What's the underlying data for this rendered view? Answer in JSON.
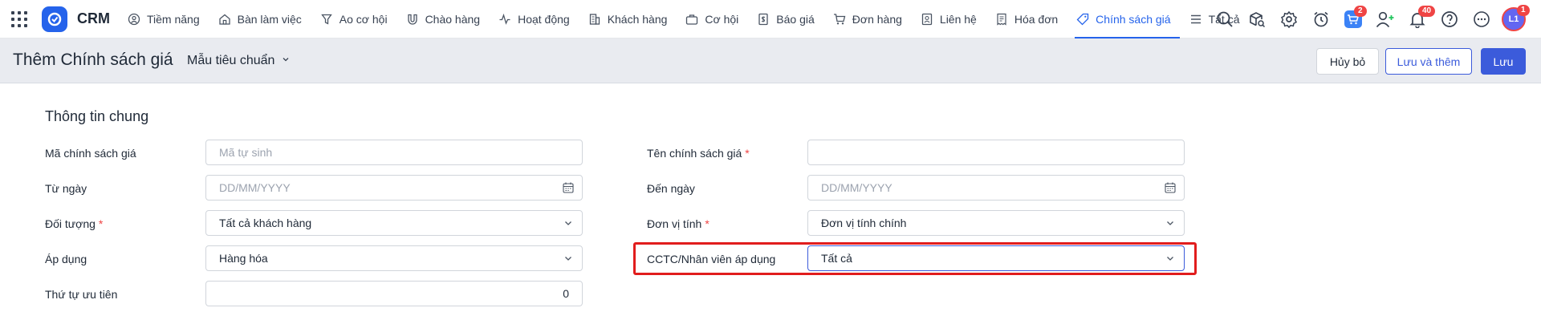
{
  "app": {
    "brand": "CRM"
  },
  "nav": {
    "items": [
      {
        "label": "Tiềm năng",
        "icon": "lead-icon"
      },
      {
        "label": "Bàn làm việc",
        "icon": "home-icon"
      },
      {
        "label": "Ao cơ hội",
        "icon": "funnel-icon"
      },
      {
        "label": "Chào hàng",
        "icon": "magnet-icon"
      },
      {
        "label": "Hoạt động",
        "icon": "activity-icon"
      },
      {
        "label": "Khách hàng",
        "icon": "building-icon"
      },
      {
        "label": "Cơ hội",
        "icon": "briefcase-icon"
      },
      {
        "label": "Báo giá",
        "icon": "quote-icon"
      },
      {
        "label": "Đơn hàng",
        "icon": "cart-icon"
      },
      {
        "label": "Liên hệ",
        "icon": "contact-icon"
      },
      {
        "label": "Hóa đơn",
        "icon": "invoice-icon"
      },
      {
        "label": "Chính sách giá",
        "icon": "tag-icon",
        "active": true
      },
      {
        "label": "Tất cả",
        "icon": "menu-icon"
      }
    ],
    "badges": {
      "cart": "2",
      "notifications": "40",
      "avatar": "1"
    },
    "avatar_initials": "L1"
  },
  "header": {
    "title": "Thêm Chính sách giá",
    "template": "Mẫu tiêu chuẩn",
    "cancel_label": "Hủy bỏ",
    "save_add_label": "Lưu và thêm",
    "save_label": "Lưu"
  },
  "form": {
    "section_title": "Thông tin chung",
    "code_label": "Mã chính sách giá",
    "code_placeholder": "Mã tự sinh",
    "name_label": "Tên chính sách giá",
    "name_value": "",
    "from_label": "Từ ngày",
    "from_placeholder": "DD/MM/YYYY",
    "to_label": "Đến ngày",
    "to_placeholder": "DD/MM/YYYY",
    "target_label": "Đối tượng",
    "target_value": "Tất cả khách hàng",
    "unit_label": "Đơn vị tính",
    "unit_value": "Đơn vị tính chính",
    "apply_label": "Áp dụng",
    "apply_value": "Hàng hóa",
    "staff_label": "CCTC/Nhân viên áp dụng",
    "staff_value": "Tất cả",
    "priority_label": "Thứ tự ưu tiên",
    "priority_value": "0",
    "required_mark": "*"
  },
  "colors": {
    "accent": "#2563eb",
    "primary_button": "#3b5bdb",
    "highlight": "#e11d1d",
    "badge": "#ef4444"
  }
}
